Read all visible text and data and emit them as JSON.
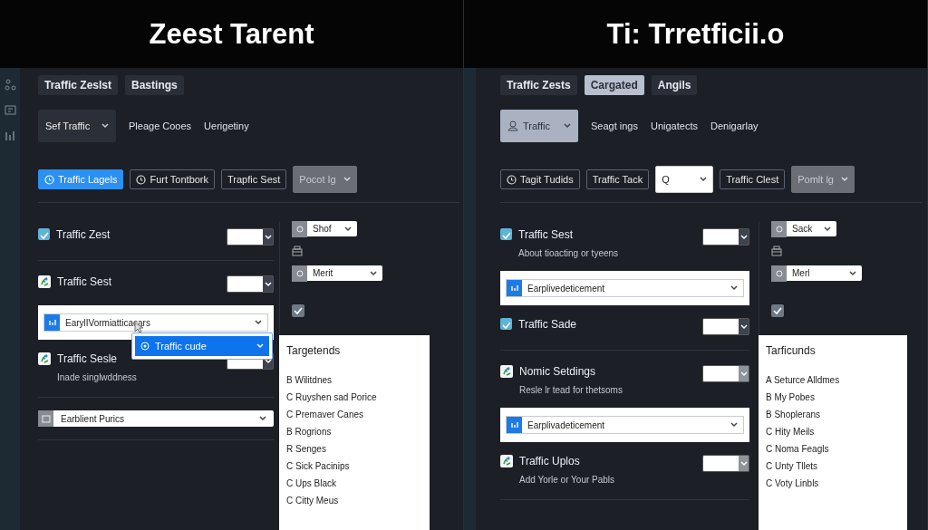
{
  "panels": [
    {
      "title": "Zeest Tarent",
      "sidebar_icons": true,
      "tabs": [
        {
          "label": "Traffic Zeslst",
          "selected": false
        },
        {
          "label": "Bastings",
          "selected": false
        }
      ],
      "toolbar": {
        "dropdown": {
          "label": "Sef Traffic",
          "selected": false,
          "icon": false
        },
        "links": [
          "Pleage Cooes",
          "Uerigetiny"
        ]
      },
      "actions": [
        {
          "kind": "button",
          "label": "Traffic Lagels",
          "primary": true,
          "icon": true
        },
        {
          "kind": "button",
          "label": "Furt Tontbork",
          "primary": false,
          "icon": true
        },
        {
          "kind": "button",
          "label": "Trapfic Sest",
          "primary": false,
          "icon": false
        },
        {
          "kind": "select",
          "label": "Pocot Ig",
          "disabled": true
        }
      ],
      "settings": [
        {
          "kind": "check",
          "label": "Traffic Zest",
          "checked": true,
          "select_disabled": false
        },
        {
          "kind": "divider"
        },
        {
          "kind": "app",
          "label": "Traffic Sest",
          "select_disabled": false
        },
        {
          "kind": "card",
          "value": "EarylIVormiatticacars"
        },
        {
          "kind": "app",
          "label": "Traffic Sesle",
          "subtitle": "Inade singlwddness",
          "select_disabled": false
        },
        {
          "kind": "divider"
        },
        {
          "kind": "select",
          "value": "Earblient Purics"
        },
        {
          "kind": "divider"
        }
      ],
      "popup": {
        "label": "Traffic cude"
      },
      "side": [
        {
          "kind": "select",
          "value": "Shof"
        },
        {
          "kind": "icon"
        },
        {
          "kind": "select",
          "value": "Merit"
        },
        {
          "kind": "check",
          "checked": true
        }
      ],
      "list": {
        "title": "Targetends",
        "items": [
          "B Wilitdnes",
          "C Ruyshen sad Porice",
          "C Premaver Canes",
          "B Rogrions",
          "R Senges",
          "C Sick Pacinips",
          "C Ups Black",
          "C Citty Meus"
        ]
      }
    },
    {
      "title": "Ti: Trretficii.o",
      "sidebar_icons": false,
      "tabs": [
        {
          "label": "Traffic Zests",
          "selected": false
        },
        {
          "label": "Cargated",
          "selected": true
        },
        {
          "label": "Angils",
          "selected": false
        }
      ],
      "toolbar": {
        "dropdown": {
          "label": "Traffic",
          "selected": true,
          "icon": true
        },
        "links": [
          "Seagt ings",
          "Unigatects",
          "Denigarlay"
        ]
      },
      "actions": [
        {
          "kind": "button",
          "label": "Tagit Tudids",
          "primary": false,
          "icon": true
        },
        {
          "kind": "button",
          "label": "Traffic Tack",
          "primary": false,
          "icon": false
        },
        {
          "kind": "select",
          "label": "Q",
          "disabled": false
        },
        {
          "kind": "button",
          "label": "Traffic Clest",
          "primary": false,
          "icon": false
        },
        {
          "kind": "select",
          "label": "Pomlt lg",
          "disabled": true
        }
      ],
      "settings": [
        {
          "kind": "check",
          "label": "Traffic Sest",
          "subtitle": "About tioacting or tyeens",
          "checked": true,
          "select_disabled": false
        },
        {
          "kind": "card",
          "value": "Earplivedeticement"
        },
        {
          "kind": "check",
          "label": "Traffic Sade",
          "checked": true,
          "select_disabled": false
        },
        {
          "kind": "divider"
        },
        {
          "kind": "app",
          "label": "Nomic Setdings",
          "subtitle": "Resle lr tead for thetsoms",
          "select_disabled": true
        },
        {
          "kind": "card",
          "value": "Earplivadeticement"
        },
        {
          "kind": "app",
          "label": "Traffic Uplos",
          "subtitle": "Add Yorle or Your Pabls",
          "select_disabled": true
        },
        {
          "kind": "divider"
        }
      ],
      "side": [
        {
          "kind": "select",
          "value": "Sack"
        },
        {
          "kind": "icon"
        },
        {
          "kind": "select",
          "value": "Merl"
        },
        {
          "kind": "check",
          "checked": true
        }
      ],
      "list": {
        "title": "Tarficunds",
        "items": [
          "A Seturce Alldmes",
          "B My Pobes",
          "B Shoplerans",
          "C Hity Meils",
          "C Noma Feagls",
          "C Unty Tllets",
          "C Voty Linbls"
        ]
      }
    }
  ]
}
